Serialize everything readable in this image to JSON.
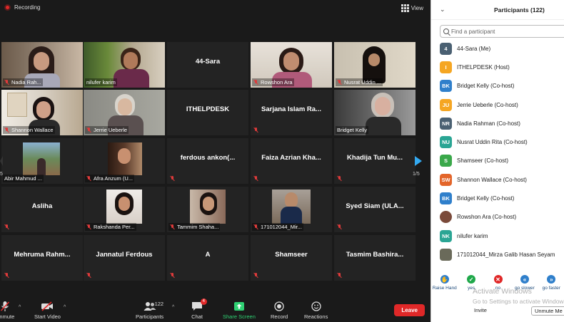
{
  "recording": {
    "label": "Recording"
  },
  "view_button": {
    "label": "View"
  },
  "tiles": [
    {
      "label": "Nadia Rah..."
    },
    {
      "label": "nilufer karim"
    },
    {
      "center": "44-Sara"
    },
    {
      "label": "Rowshon Ara"
    },
    {
      "label": "Nusrat Uddin ..."
    },
    {
      "label": "Shannon Wallace"
    },
    {
      "label": "Jerrie Ueberle"
    },
    {
      "center": "ITHELPDESK"
    },
    {
      "center": "Sarjana Islam Ra..."
    },
    {
      "label": "Bridget Kelly"
    },
    {
      "label": "Abir Mahmud ..."
    },
    {
      "label": "Afra Anzum (U..."
    },
    {
      "center": "ferdous ankon(..."
    },
    {
      "center": "Faiza Azrian Kha..."
    },
    {
      "center": "Khadija Tun Mu..."
    },
    {
      "center": "Asliha"
    },
    {
      "label": "Rakshanda Per..."
    },
    {
      "label": "Tammim Shaha..."
    },
    {
      "label": "171012044_Mir..."
    },
    {
      "center": "Syed Siam (ULA..."
    },
    {
      "center": "Mehruma Rahm..."
    },
    {
      "center": "Jannatul Ferdous"
    },
    {
      "center": "A"
    },
    {
      "center": "Shamseer"
    },
    {
      "center": "Tasmim Bashira..."
    }
  ],
  "pagination": {
    "left": "5",
    "right": "1/5"
  },
  "toolbar": {
    "unmute": "Unmute",
    "start_video": "Start Video",
    "participants": "Participants",
    "participant_count": "122",
    "chat": "Chat",
    "chat_badge": "4",
    "share_screen": "Share Screen",
    "record": "Record",
    "reactions": "Reactions",
    "leave": "Leave"
  },
  "panel": {
    "title": "Participants (122)",
    "search_placeholder": "Find a participant",
    "participants": [
      {
        "initials": "4",
        "name": "44-Sara (Me)",
        "color": "#4a6072"
      },
      {
        "initials": "I",
        "name": "ITHELPDESK (Host)",
        "color": "#f5a623"
      },
      {
        "initials": "BK",
        "name": "Bridget Kelly (Co-host)",
        "color": "#2f7fcb"
      },
      {
        "initials": "JU",
        "name": "Jerrie Ueberle (Co-host)",
        "color": "#f5a623"
      },
      {
        "initials": "NR",
        "name": "Nadia Rahman (Co-host)",
        "color": "#4a6072"
      },
      {
        "initials": "NU",
        "name": "Nusrat Uddin Rita (Co-host)",
        "color": "#2aa594"
      },
      {
        "initials": "S",
        "name": "Shamseer (Co-host)",
        "color": "#3aa84a"
      },
      {
        "initials": "SW",
        "name": "Shannon Wallace (Co-host)",
        "color": "#e3652a"
      },
      {
        "initials": "BK",
        "name": "Bridget Kelly (Co-host)",
        "color": "#2f7fcb"
      },
      {
        "initials": "",
        "name": "Rowshon Ara (Co-host)",
        "color": "#7a4a3a"
      },
      {
        "initials": "NK",
        "name": "nilufer karim",
        "color": "#2aa594"
      },
      {
        "initials": "",
        "name": "171012044_Mirza Galib Hasan Seyam",
        "color": "#6a6a5a"
      }
    ],
    "actions": [
      {
        "label": "Raise Hand",
        "color": "#2f7fcb",
        "symbol": "✋"
      },
      {
        "label": "yes",
        "color": "#1fa84a",
        "symbol": "✓"
      },
      {
        "label": "no",
        "color": "#e02828",
        "symbol": "✕"
      },
      {
        "label": "go slower",
        "color": "#2f7fcb",
        "symbol": "«"
      },
      {
        "label": "go faster",
        "color": "#2f7fcb",
        "symbol": "»"
      }
    ],
    "invite": "Invite",
    "unmute_me": "Unmute Me"
  },
  "watermark": {
    "line1": "Activate Windows",
    "line2": "Go to Settings to activate Windows."
  }
}
